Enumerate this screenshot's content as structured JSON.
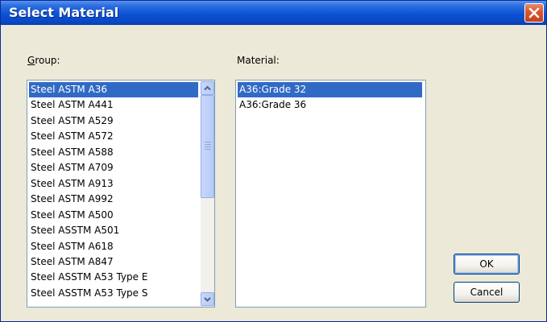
{
  "window": {
    "title": "Select Material"
  },
  "group": {
    "label": "Group:",
    "items": [
      "Steel ASTM A36",
      "Steel ASTM A441",
      "Steel ASTM A529",
      "Steel ASTM A572",
      "Steel ASTM A588",
      "Steel ASTM A709",
      "Steel ASTM A913",
      "Steel ASTM A992",
      "Steel ASTM A500",
      "Steel ASSTM A501",
      "Steel ASTM A618",
      "Steel ASTM A847",
      "Steel ASSTM A53 Type E",
      "Steel ASSTM A53 Type S"
    ],
    "selected": "Steel ASTM A36"
  },
  "material": {
    "label": "Material:",
    "items": [
      "A36:Grade 32",
      "A36:Grade 36"
    ],
    "selected": "A36:Grade 32"
  },
  "buttons": {
    "ok": "OK",
    "cancel": "Cancel"
  },
  "colors": {
    "selection": "#316ac5",
    "titlebar": "#0a48c6",
    "dialog_bg": "#ece9d8"
  },
  "icons": {
    "close": "close-icon",
    "scroll_up": "chevron-up-icon",
    "scroll_down": "chevron-down-icon"
  }
}
